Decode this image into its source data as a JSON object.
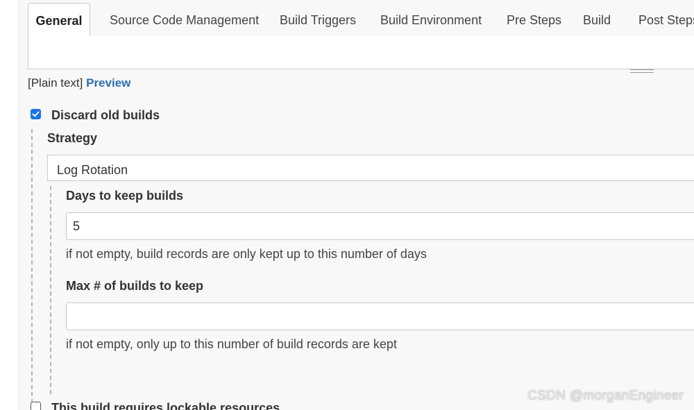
{
  "tabs": [
    {
      "label": "General",
      "active": true
    },
    {
      "label": "Source Code Management",
      "active": false
    },
    {
      "label": "Build Triggers",
      "active": false
    },
    {
      "label": "Build Environment",
      "active": false
    },
    {
      "label": "Pre Steps",
      "active": false
    },
    {
      "label": "Build",
      "active": false
    },
    {
      "label": "Post Steps",
      "active": false
    }
  ],
  "description": {
    "format_label": "[Plain text]",
    "preview_link": "Preview"
  },
  "discard_old_builds": {
    "label": "Discard old builds",
    "checked": true,
    "strategy_label": "Strategy",
    "strategy_value": "Log Rotation",
    "days_to_keep": {
      "label": "Days to keep builds",
      "value": "5",
      "help": "if not empty, build records are only kept up to this number of days"
    },
    "max_builds": {
      "label": "Max # of builds to keep",
      "value": "",
      "help": "if not empty, only up to this number of build records are kept"
    }
  },
  "lockable_resources": {
    "label": "This build requires lockable resources",
    "checked": false
  },
  "watermark": "CSDN @morganEngineer",
  "colors": {
    "accent": "#1a73e8",
    "link": "#2a6fb0",
    "background": "#f8f8f8",
    "border": "#c9c9c9"
  }
}
